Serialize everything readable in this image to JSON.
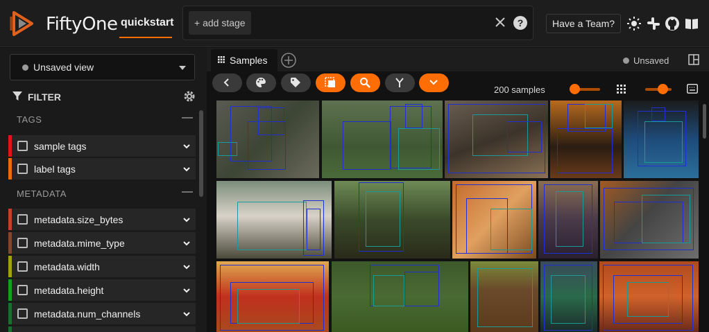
{
  "header": {
    "brand": "FiftyOne",
    "dataset": "quickstart",
    "add_stage": "+ add stage",
    "team_button": "Have a Team?"
  },
  "sidebar": {
    "view_select": "Unsaved view",
    "filter_label": "FILTER",
    "sections": [
      {
        "label": "TAGS",
        "rows": [
          {
            "label": "sample tags",
            "color": "#e0141d"
          },
          {
            "label": "label tags",
            "color": "#ee6b0c"
          }
        ]
      },
      {
        "label": "METADATA",
        "rows": [
          {
            "label": "metadata.size_bytes",
            "color": "#c4402b"
          },
          {
            "label": "metadata.mime_type",
            "color": "#7f4a2b"
          },
          {
            "label": "metadata.width",
            "color": "#a2a20a"
          },
          {
            "label": "metadata.height",
            "color": "#14a01f"
          },
          {
            "label": "metadata.num_channels",
            "color": "#1a6f2a"
          }
        ]
      }
    ]
  },
  "tabs": {
    "samples_label": "Samples",
    "unsaved_label": "Unsaved"
  },
  "toolbar": {
    "sample_count": "200 samples"
  },
  "colors": {
    "accent": "#ff6d04",
    "box_blue": "#1f2fd0",
    "box_teal": "#1b9a9a"
  },
  "gallery": {
    "tiles": [
      {
        "bg": "linear-gradient(135deg,#5a5a52,#3d4535 50%,#6b6a5c)"
      },
      {
        "bg": "linear-gradient(180deg,#5e7150,#3f5833 60%,#4a6b3a)"
      },
      {
        "bg": "linear-gradient(160deg,#6b5f52,#3c332a 50%,#8a7155)"
      },
      {
        "bg": "linear-gradient(180deg,#b86a1e,#2a1d12 60%,#6a3a1a)"
      },
      {
        "bg": "linear-gradient(180deg,#1b1b1b,#1e4b7a 50%,#2c6f9b)"
      },
      {
        "bg": "linear-gradient(180deg,#7c8d7c,#d8d2c8 45%,#4a4a3a)"
      },
      {
        "bg": "linear-gradient(180deg,#6e8a55,#3a4a2a 50%,#2a2a1a)"
      },
      {
        "bg": "linear-gradient(135deg,#c46a2c,#e0a060 50%,#7a4a20)"
      },
      {
        "bg": "linear-gradient(180deg,#8a6e52,#4a3a4a 50%,#2a2030)"
      },
      {
        "bg": "linear-gradient(135deg,#a25a22,#444444 45%,#6e6e6e)"
      },
      {
        "bg": "linear-gradient(180deg,#e0aa50,#c0301e 50%,#a84a1e)"
      },
      {
        "bg": "linear-gradient(180deg,#3d5a2a,#4a6a34 50%,#3a5a22)"
      },
      {
        "bg": "linear-gradient(180deg,#7a8a3a,#6a4a2a 40%,#5a3a1a)"
      },
      {
        "bg": "linear-gradient(180deg,#3a4a5a,#2a6a4a 50%,#1a2a2a)"
      },
      {
        "bg": "linear-gradient(180deg,#b04a1e,#d0622a 50%,#6a2a1a)"
      }
    ]
  }
}
